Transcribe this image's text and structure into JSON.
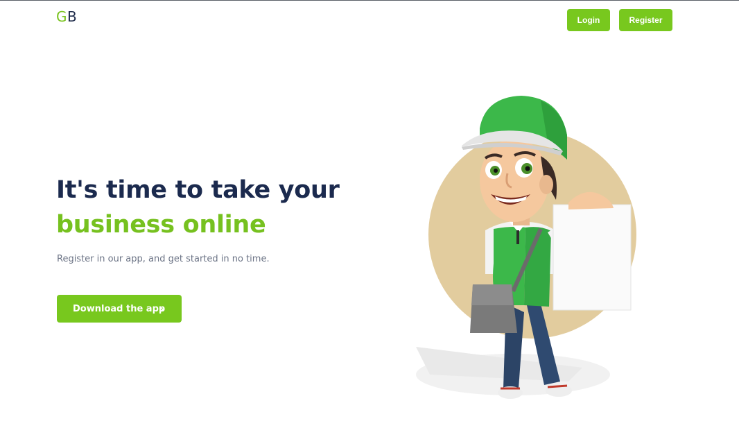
{
  "header": {
    "logo_g": "G",
    "logo_b": "B",
    "login_label": "Login",
    "register_label": "Register"
  },
  "hero": {
    "headline_line1": "It's time to take your",
    "headline_line2": "business online",
    "subtitle": "Register in our app, and get started in no time.",
    "download_label": "Download the app",
    "download_icon": "chevron-right-icon"
  },
  "colors": {
    "accent": "#78c81e",
    "headline_dark": "#1b2a4e",
    "headline_green": "#76c11f",
    "subtitle": "#6b7385",
    "illustration_circle": "#e2cc9e"
  },
  "illustration": {
    "icon": "delivery-man-illustration"
  }
}
